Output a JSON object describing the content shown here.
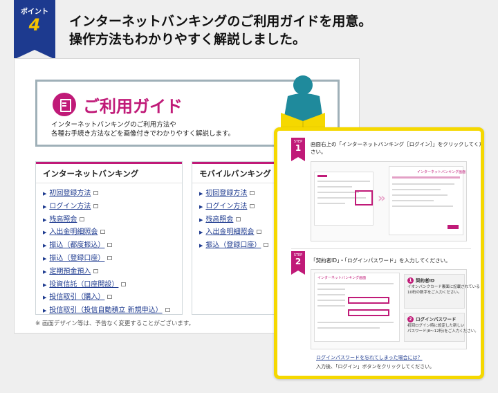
{
  "point": {
    "label": "ポイント",
    "number": "4"
  },
  "headline": {
    "line1": "インターネットバンキングのご利用ガイドを用意。",
    "line2": "操作方法もわかりやすく解説しました。"
  },
  "guide": {
    "title": "ご利用ガイド",
    "desc_line1": "インターネットバンキングのご利用方法や",
    "desc_line2": "各種お手続き方法などを画像付きでわかりやすく解説します。"
  },
  "internet_banking": {
    "heading": "インターネットバンキング",
    "items": [
      "初回登録方法",
      "ログイン方法",
      "残高照会",
      "入出金明細照会",
      "振込（都度振込）",
      "振込（登録口座）",
      "定期預金預入",
      "投資信託（口座開設）",
      "投信取引（購入）",
      "投信取引（投信自動積立 新規申込）"
    ]
  },
  "mobile_banking": {
    "heading": "モバイルバンキング",
    "items": [
      "初回登録方法",
      "ログイン方法",
      "残高照会",
      "入出金明細照会",
      "振込（登録口座）"
    ]
  },
  "note": "※ 画面デザイン等は、予告なく変更することがございます。",
  "steps": {
    "step_word": "STEP",
    "step1": {
      "number": "1",
      "line1": "画面右上の「インターネットバンキング［ログイン］」をクリックしてくだ",
      "line2": "さい。",
      "thumb_title": "インターネットバンキング画面"
    },
    "step2": {
      "number": "2",
      "line1": "「契約者ID」・「ログインパスワード」を入力してください。",
      "thumb_title": "インターネットバンキング画面",
      "callout1_title": "契約者ID",
      "callout1_line1": "イオンバンクカード裏面に記載されている",
      "callout1_line2": "10桁の数字をご入力ください。",
      "callout2_title": "ログインパスワード",
      "callout2_line1": "初回ログイン時に設定した新しい",
      "callout2_line2": "パスワード(8～12桁)をご入力ください。",
      "forgot_link": "ログインパスワードを忘れてしまった場合には？",
      "after_input": "入力後、「ログイン」ボタンをクリックしてください。"
    }
  },
  "colors": {
    "brand_navy": "#1d3a8f",
    "accent_magenta": "#c01a78",
    "highlight_yellow": "#f5d800",
    "figure_teal": "#1f8a9c"
  }
}
